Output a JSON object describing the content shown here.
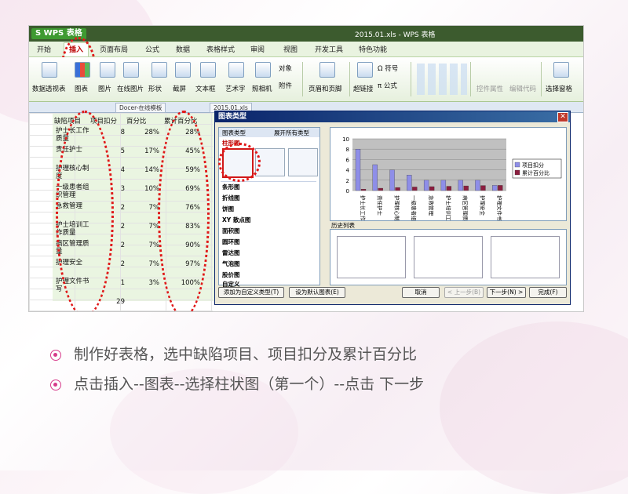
{
  "window": {
    "logo": "S WPS 表格",
    "file_title": "2015.01.xls - WPS 表格"
  },
  "menu_tabs": [
    "开始",
    "插入",
    "页面布局",
    "公式",
    "数据",
    "表格样式",
    "审阅",
    "视图",
    "开发工具",
    "特色功能"
  ],
  "active_tab": "插入",
  "ribbon": {
    "pivot": "数据透视表",
    "chart": "图表",
    "picture": "图片",
    "online_picture": "在线图片",
    "shapes": "形状",
    "screenshot": "截屏",
    "textbox": "文本框",
    "wordart": "艺术字",
    "camera": "照相机",
    "object": "对象",
    "attachment": "附件",
    "header_footer": "页眉和页脚",
    "hyperlink": "超链接",
    "symbol": "符号",
    "formula": "公式",
    "control_props": "控件属性",
    "edit_code": "编辑代码",
    "select_pane": "选择窗格"
  },
  "doc_tabs": [
    "Docer-在线模板",
    "2015.01.xls"
  ],
  "sheet": {
    "headers": [
      "缺陷项目",
      "项目扣分",
      "百分比",
      "累计百分比"
    ],
    "rows": [
      {
        "item": "护士长工作质量",
        "score": "8",
        "pct": "28%",
        "cum": "28%"
      },
      {
        "item": "责任护士",
        "score": "5",
        "pct": "17%",
        "cum": "45%"
      },
      {
        "item": "护理核心制度",
        "score": "4",
        "pct": "14%",
        "cum": "59%"
      },
      {
        "item": "一级患者组织管理",
        "score": "3",
        "pct": "10%",
        "cum": "69%"
      },
      {
        "item": "急救管理",
        "score": "2",
        "pct": "7%",
        "cum": "76%"
      },
      {
        "item": "护士培训工作质量",
        "score": "2",
        "pct": "7%",
        "cum": "83%"
      },
      {
        "item": "病区管理质量",
        "score": "2",
        "pct": "7%",
        "cum": "90%"
      },
      {
        "item": "护理安全",
        "score": "2",
        "pct": "7%",
        "cum": "97%"
      },
      {
        "item": "护理文件书写",
        "score": "1",
        "pct": "3%",
        "cum": "100%"
      }
    ],
    "total": "29"
  },
  "dialog": {
    "title": "图表类型",
    "list_header": "图表类型",
    "list_header_right": "展开所有类型",
    "types": [
      "柱形图",
      "条形图",
      "折线图",
      "饼图",
      "XY 散点图",
      "面积图",
      "圆环图",
      "雷达图",
      "气泡图",
      "股价图",
      "自定义"
    ],
    "history_label": "历史列表",
    "buttons": [
      "添加为自定义类型(T)",
      "设为默认图表(E)",
      "取消",
      "< 上一步(B)",
      "下一步(N) >",
      "完成(F)"
    ],
    "legend": [
      "项目扣分",
      "累计百分比"
    ],
    "preview_colors": [
      "#8e8ee8",
      "#8b1e3f"
    ]
  },
  "chart_data": {
    "type": "bar",
    "categories": [
      "护士长工作质量",
      "责任护士",
      "护理核心制度",
      "一级患者组织管理",
      "急救管理",
      "护士培训工作质量",
      "病区管理质量",
      "护理安全",
      "护理文件书写"
    ],
    "series": [
      {
        "name": "项目扣分",
        "values": [
          8,
          5,
          4,
          3,
          2,
          2,
          2,
          2,
          1
        ]
      },
      {
        "name": "累计百分比",
        "values": [
          0.28,
          0.45,
          0.59,
          0.69,
          0.76,
          0.83,
          0.9,
          0.97,
          1.0
        ]
      }
    ],
    "yticks": [
      0,
      2,
      4,
      6,
      8,
      10
    ],
    "ylim": [
      0,
      10
    ]
  },
  "bullets": [
    "制作好表格，选中缺陷项目、项目扣分及累计百分比",
    "点击插入--图表--选择柱状图（第一个）--点击   下一步"
  ]
}
